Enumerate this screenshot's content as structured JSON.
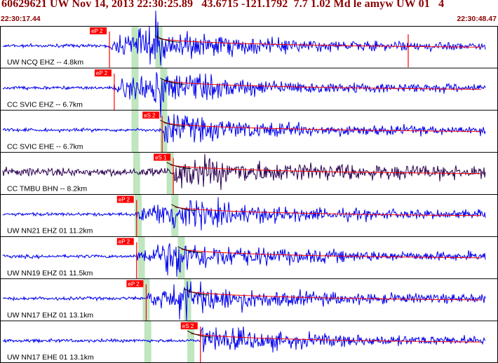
{
  "header": {
    "title": "60629621 UW Nov 14, 2013 22:30:25.89   43.6715 -121.1792  7.7 1.02 Md le amyw UW 01   4",
    "time_start": "22:30:17.44",
    "time_end": "22:30:48.47",
    "color": "#8b0000"
  },
  "chart_data": {
    "type": "line",
    "x_unit": "time",
    "xlim": [
      "22:30:17.44",
      "22:30:48.47"
    ],
    "traces": [
      {
        "label": "UW NCQ EHZ -- 4.8km",
        "color": "#0000ee",
        "picks": [
          {
            "label": "eP 2",
            "t": "22:30:24.3"
          }
        ],
        "p_window": "22:30:25.9",
        "s_window": "22:30:27.4"
      },
      {
        "label": "CC SVIC EHZ -- 6.7km",
        "color": "#0000ee",
        "picks": [
          {
            "label": "eP 2",
            "t": "22:30:24.6"
          }
        ],
        "p_window": "22:30:25.9",
        "s_window": "22:30:27.7"
      },
      {
        "label": "CC SVIC EHE -- 6.7km",
        "color": "#0000ee",
        "picks": [
          {
            "label": "eS 2",
            "t": "22:30:27.6"
          }
        ],
        "p_window": "22:30:25.9",
        "s_window": "22:30:27.7"
      },
      {
        "label": "CC TMBU BHN -- 8.2km",
        "color": "#2a0050",
        "picks": [
          {
            "label": "eS 1",
            "t": "22:30:28.3"
          }
        ],
        "p_window": "22:30:26.0",
        "s_window": "22:30:28.1"
      },
      {
        "label": "UW NN21 EHZ 01 11.2km",
        "color": "#0000ee",
        "picks": [
          {
            "label": "eP 2",
            "t": "22:30:26.0"
          }
        ],
        "p_window": "22:30:26.1",
        "s_window": "22:30:28.4"
      },
      {
        "label": "UW NN19 EHZ 01 11.5km",
        "color": "#0000ee",
        "picks": [
          {
            "label": "eP 2",
            "t": "22:30:26.0"
          }
        ],
        "p_window": "22:30:26.3",
        "s_window": "22:30:28.8"
      },
      {
        "label": "UW NN17 EHZ 01 13.1km",
        "color": "#0000ee",
        "picks": [
          {
            "label": "eP 2",
            "t": "22:30:26.6"
          }
        ],
        "p_window": "22:30:26.6",
        "s_window": "22:30:29.2"
      },
      {
        "label": "UW NN17 EHE 01 13.1km",
        "color": "#0000ee",
        "picks": [
          {
            "label": "eS 2",
            "t": "22:30:30.0"
          }
        ],
        "p_window": "22:30:26.7",
        "s_window": "22:30:29.4"
      }
    ],
    "grid": true,
    "pick_color": "#ff0000",
    "window_color": "#bfe6bf"
  }
}
